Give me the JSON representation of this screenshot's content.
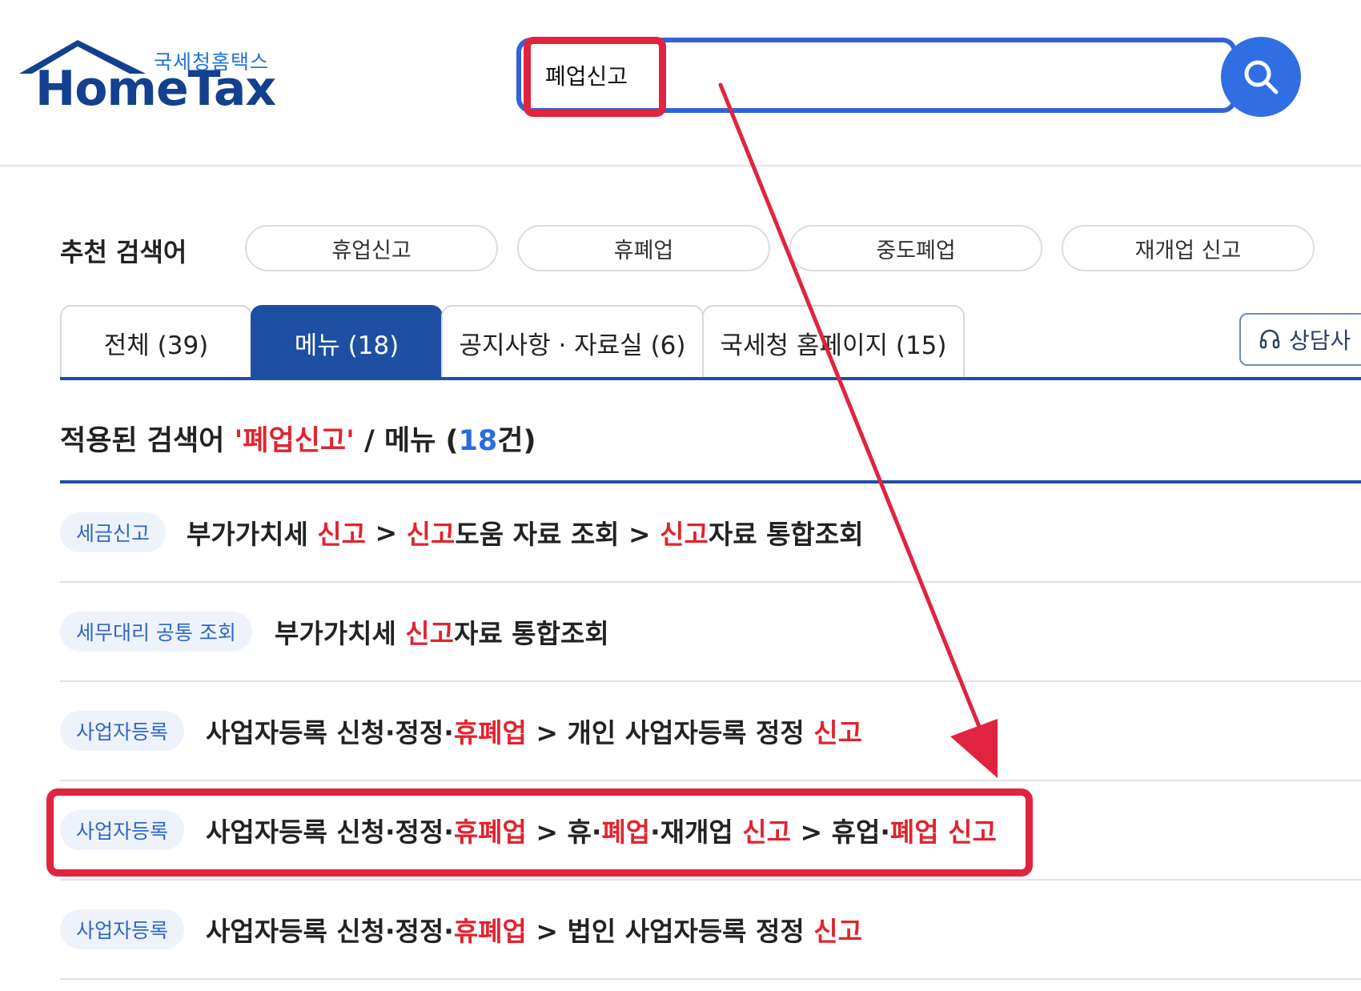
{
  "header": {
    "logo_kr": "국세청홈택스",
    "logo_en": "HomeTax",
    "search_value": "폐업신고",
    "search_icon": "search-icon"
  },
  "recommended": {
    "label": "추천 검색어",
    "chips": [
      "휴업신고",
      "휴폐업",
      "중도폐업",
      "재개업 신고"
    ]
  },
  "tabs": [
    {
      "label": "전체 (39)",
      "active": false
    },
    {
      "label": "메뉴 (18)",
      "active": true
    },
    {
      "label": "공지사항 · 자료실 (6)",
      "active": false
    },
    {
      "label": "국세청 홈페이지 (15)",
      "active": false
    }
  ],
  "consult": {
    "label": "상담사",
    "icon": "headset-icon"
  },
  "applied": {
    "prefix": "적용된 검색어 ",
    "keyword": "'폐업신고'",
    "middle": " / 메뉴 (",
    "count": "18",
    "suffix": "건)"
  },
  "results": [
    {
      "badge": "세금신고",
      "parts": [
        [
          "부가가치세 ",
          false
        ],
        [
          "신고",
          true
        ],
        [
          " > ",
          false
        ],
        [
          "신고",
          true
        ],
        [
          "도움 자료 조회 > ",
          false
        ],
        [
          "신고",
          true
        ],
        [
          "자료 통합조회",
          false
        ]
      ]
    },
    {
      "badge": "세무대리 공통 조회",
      "parts": [
        [
          "부가가치세 ",
          false
        ],
        [
          "신고",
          true
        ],
        [
          "자료 통합조회",
          false
        ]
      ]
    },
    {
      "badge": "사업자등록",
      "parts": [
        [
          "사업자등록 신청·정정·",
          false
        ],
        [
          "휴폐업",
          true
        ],
        [
          " > 개인 사업자등록 정정 ",
          false
        ],
        [
          "신고",
          true
        ]
      ]
    },
    {
      "badge": "사업자등록",
      "parts": [
        [
          "사업자등록 신청·정정·",
          false
        ],
        [
          "휴폐업",
          true
        ],
        [
          " > 휴·",
          false
        ],
        [
          "폐업",
          true
        ],
        [
          "·재개업 ",
          false
        ],
        [
          "신고",
          true
        ],
        [
          " > 휴업·",
          false
        ],
        [
          "폐업",
          true
        ],
        [
          " ",
          false
        ],
        [
          "신고",
          true
        ]
      ]
    },
    {
      "badge": "사업자등록",
      "parts": [
        [
          "사업자등록 신청·정정·",
          false
        ],
        [
          "휴폐업",
          true
        ],
        [
          " > 법인 사업자등록 정정 ",
          false
        ],
        [
          "신고",
          true
        ]
      ]
    }
  ],
  "colors": {
    "brand_blue": "#1e4fa3",
    "search_blue": "#2f6fe3",
    "highlight_red": "#e0242f",
    "annotation_red": "#e0243f"
  }
}
